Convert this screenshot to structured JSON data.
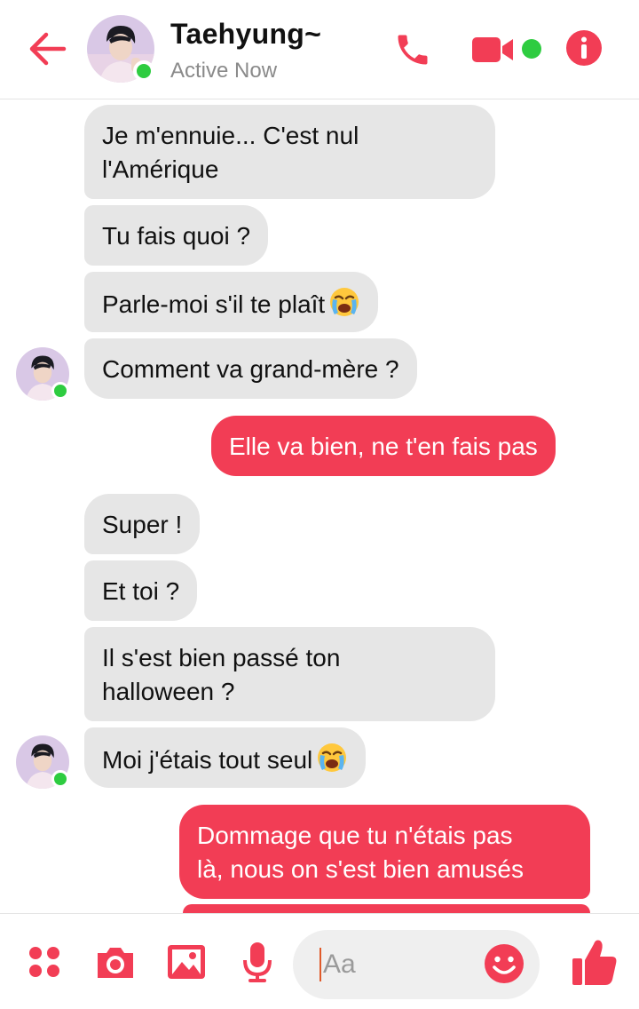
{
  "header": {
    "contact_name": "Taehyung~",
    "status": "Active Now",
    "icons": [
      "back-arrow-icon",
      "phone-icon",
      "video-camera-icon",
      "info-icon"
    ]
  },
  "colors": {
    "accent": "#f23d55",
    "incoming_bubble": "#e6e6e6",
    "online": "#2ecc40"
  },
  "messages": [
    {
      "from": "them",
      "text": "Je m'ennuie... C'est nul\nl'Amérique"
    },
    {
      "from": "them",
      "text": "Tu fais quoi ?"
    },
    {
      "from": "them",
      "text": "Parle-moi s'il te plaît",
      "emoji": "loudly-crying-face"
    },
    {
      "from": "them",
      "text": "Comment va grand-mère ?"
    },
    {
      "from": "me",
      "text": "Elle va bien, ne t'en fais pas"
    },
    {
      "from": "them",
      "text": "Super !"
    },
    {
      "from": "them",
      "text": "Et toi ?"
    },
    {
      "from": "them",
      "text": "Il s'est bien passé ton\nhalloween ?"
    },
    {
      "from": "them",
      "text": "Moi j'étais tout seul",
      "emoji": "loudly-crying-face"
    },
    {
      "from": "me",
      "text": "Dommage que tu n'étais pas\nlà, nous on s'est bien amusés"
    },
    {
      "from": "me",
      "text": ""
    }
  ],
  "composer": {
    "placeholder": "Aa",
    "icons": [
      "apps-grid-icon",
      "camera-icon",
      "image-icon",
      "microphone-icon",
      "smiley-icon",
      "thumbs-up-icon"
    ]
  }
}
